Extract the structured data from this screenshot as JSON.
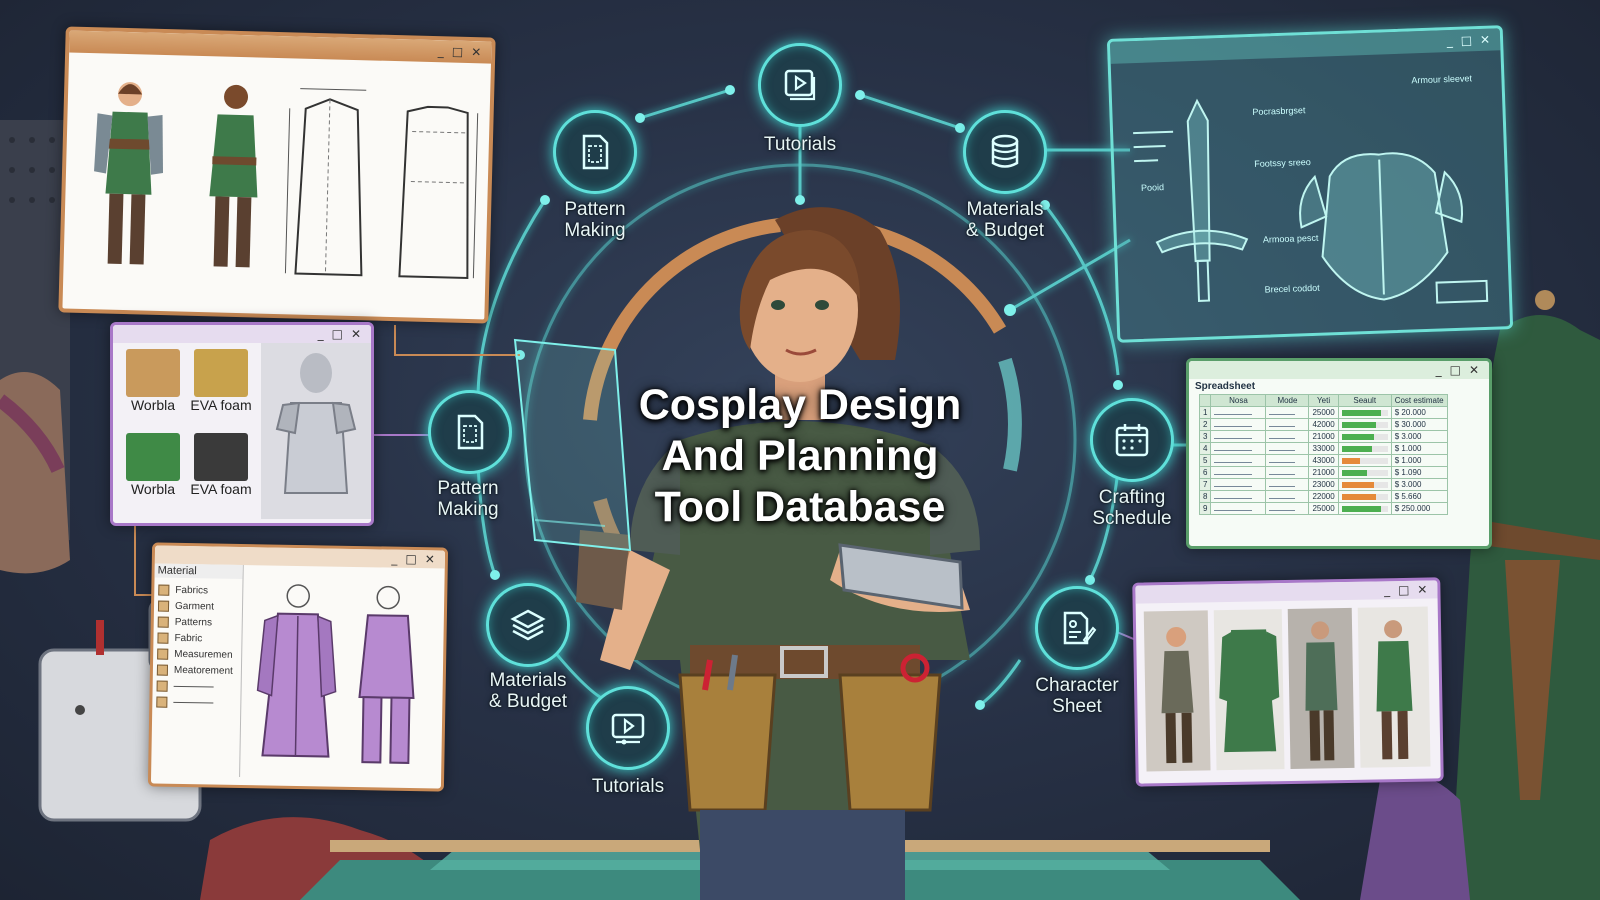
{
  "title": {
    "line1": "Cosplay Design",
    "line2": "And Planning",
    "line3": "Tool Database"
  },
  "nodes": {
    "tutorials_top": "Tutorials",
    "pattern_making_top": {
      "line1": "Pattern",
      "line2": "Making"
    },
    "materials_budget_top": {
      "line1": "Materials",
      "line2": "& Budget"
    },
    "pattern_making_left": {
      "line1": "Pattern",
      "line2": "Making"
    },
    "crafting_schedule": {
      "line1": "Crafting",
      "line2": "Schedule"
    },
    "materials_budget_bottom": {
      "line1": "Materials",
      "line2": "& Budget"
    },
    "character_sheet": {
      "line1": "Character",
      "line2": "Sheet"
    },
    "tutorials_bottom": "Tutorials"
  },
  "window_controls": {
    "minimize": "_",
    "maximize": "□",
    "close": "✕"
  },
  "materials_panel": {
    "swatches": [
      {
        "label": "Worbla",
        "color": "#c99a5c"
      },
      {
        "label": "EVA foam",
        "color": "#c8a24c"
      },
      {
        "label": "Worbla",
        "color": "#3f8a46"
      },
      {
        "label": "EVA foam",
        "color": "#3a3a3a"
      }
    ]
  },
  "material_list_panel": {
    "header": "Material",
    "items": [
      "Fabrics",
      "Garment",
      "Patterns",
      "Fabric",
      "Measuremen",
      "Meatorement",
      "",
      ""
    ]
  },
  "spreadsheet_panel": {
    "title": "Spreadsheet",
    "headers": [
      "",
      "Nosa",
      "Mode",
      "Yeti",
      "Seault",
      "Cost estimate"
    ],
    "rows": [
      {
        "n": "1",
        "qty": "25000",
        "fill": 0.85,
        "color": "#4caf50",
        "cost": "$ 20.000"
      },
      {
        "n": "2",
        "qty": "42000",
        "fill": 0.75,
        "color": "#4caf50",
        "cost": "$ 30.000"
      },
      {
        "n": "3",
        "qty": "21000",
        "fill": 0.7,
        "color": "#4caf50",
        "cost": "$ 3.000"
      },
      {
        "n": "4",
        "qty": "33000",
        "fill": 0.65,
        "color": "#4caf50",
        "cost": "$ 1.000"
      },
      {
        "n": "5",
        "qty": "43000",
        "fill": 0.4,
        "color": "#e58a3a",
        "cost": "$ 1.000"
      },
      {
        "n": "6",
        "qty": "21000",
        "fill": 0.55,
        "color": "#4caf50",
        "cost": "$ 1.090"
      },
      {
        "n": "7",
        "qty": "23000",
        "fill": 0.7,
        "color": "#e58a3a",
        "cost": "$ 3.000"
      },
      {
        "n": "8",
        "qty": "22000",
        "fill": 0.75,
        "color": "#e58a3a",
        "cost": "$ 5.660"
      },
      {
        "n": "9",
        "qty": "25000",
        "fill": 0.85,
        "color": "#4caf50",
        "cost": "$ 250.000"
      }
    ]
  },
  "blueprint_panel": {
    "labels": [
      "Armour sleevet",
      "Pocrasbrgset",
      "Footssy sreeo",
      "Pooid",
      "Armooa pesct",
      "Brecel coddot"
    ]
  },
  "colors": {
    "accent": "#5fe0da",
    "copper": "#c98a55",
    "purple": "#a878c8",
    "green": "#5a9e6a"
  }
}
